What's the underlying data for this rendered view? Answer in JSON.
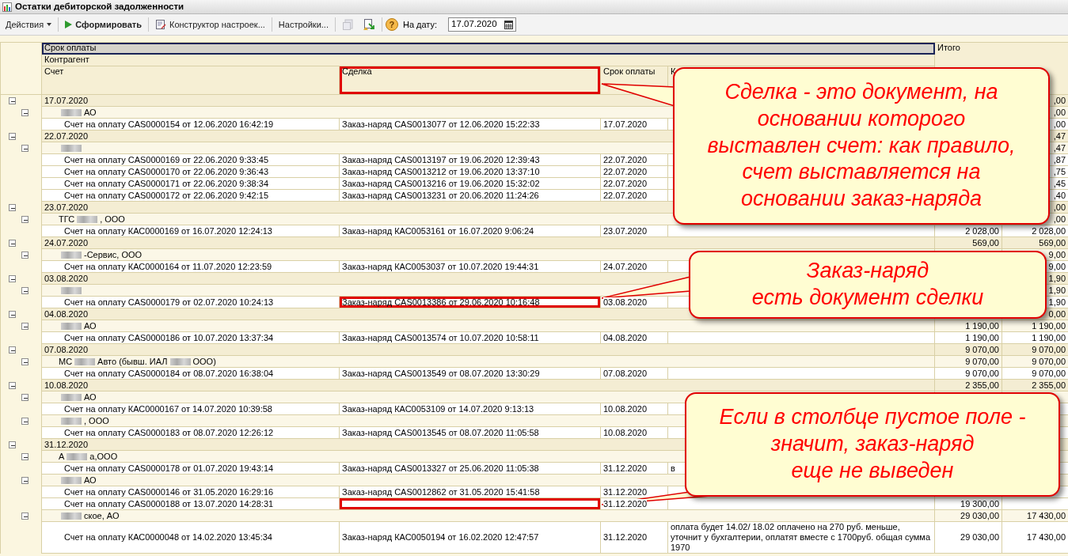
{
  "window": {
    "title": "Остатки дебиторской задолженности"
  },
  "toolbar": {
    "items": [
      {
        "kind": "menu",
        "label": "Действия",
        "disabled": false
      },
      {
        "kind": "run",
        "label": "Сформировать",
        "disabled": false
      },
      {
        "kind": "wizard",
        "label": "Конструктор настроек...",
        "disabled": false
      },
      {
        "kind": "text",
        "label": "Настройки...",
        "disabled": false
      },
      {
        "kind": "save",
        "disabled": true
      },
      {
        "kind": "load",
        "disabled": false
      },
      {
        "kind": "help",
        "label": "?",
        "disabled": false
      }
    ],
    "date_field": {
      "label": "На дату:",
      "value": "17.07.2020"
    }
  },
  "table": {
    "header": {
      "group_1": "Срок оплаты",
      "group_1_selected": true,
      "group_2": "Контрагент",
      "total": "Итого",
      "columns": [
        {
          "label": "Счет",
          "highlighted": false
        },
        {
          "label": "Сделка",
          "highlighted": true
        },
        {
          "label": "Срок оплаты",
          "highlighted": false
        },
        {
          "label": "К",
          "highlighted": false
        }
      ]
    },
    "groups": [
      {
        "date": "17.07.2020",
        "expanded": true,
        "total_2": ",00",
        "children": [
          {
            "name": [
              {
                "kind": "redacted"
              },
              {
                "kind": "text",
                "text": "АО"
              }
            ],
            "expanded": true,
            "total_2": ",00",
            "children": [
              {
                "invoice": "Счет на оплату CAS0000154 от 12.06.2020 16:42:19",
                "deal": "Заказ-наряд CAS0013077 от 12.06.2020 15:22:33",
                "highlighted": false,
                "due": "17.07.2020",
                "total_2": ",00"
              }
            ]
          }
        ]
      },
      {
        "date": "22.07.2020",
        "expanded": true,
        "total_2": ",47",
        "children": [
          {
            "name": [
              {
                "kind": "redacted"
              }
            ],
            "expanded": true,
            "total_2": ",47",
            "children": [
              {
                "invoice": "Счет на оплату CAS0000169 от 22.06.2020 9:33:45",
                "deal": "Заказ-наряд CAS0013197 от 19.06.2020 12:39:43",
                "highlighted": false,
                "due": "22.07.2020",
                "total_2": ",87"
              },
              {
                "invoice": "Счет на оплату CAS0000170 от 22.06.2020 9:36:43",
                "deal": "Заказ-наряд CAS0013212 от 19.06.2020 13:37:10",
                "highlighted": false,
                "due": "22.07.2020",
                "total_2": ",75"
              },
              {
                "invoice": "Счет на оплату CAS0000171 от 22.06.2020 9:38:34",
                "deal": "Заказ-наряд CAS0013216 от 19.06.2020 15:32:02",
                "highlighted": false,
                "due": "22.07.2020",
                "total_2": ",45"
              },
              {
                "invoice": "Счет на оплату CAS0000172 от 22.06.2020 9:42:15",
                "deal": "Заказ-наряд CAS0013231 от 20.06.2020 11:24:26",
                "highlighted": false,
                "due": "22.07.2020",
                "total_2": ",40"
              }
            ]
          }
        ]
      },
      {
        "date": "23.07.2020",
        "expanded": true,
        "total_2": ",00",
        "children": [
          {
            "name": [
              {
                "kind": "text",
                "text": "ТГС"
              },
              {
                "kind": "redacted"
              },
              {
                "kind": "text",
                "text": ", ООО"
              }
            ],
            "expanded": true,
            "total_2": ",00",
            "children": [
              {
                "invoice": "Счет на оплату КАС0000169 от 16.07.2020 12:24:13",
                "deal": "Заказ-наряд КАС0053161 от 16.07.2020 9:06:24",
                "highlighted": false,
                "due": "23.07.2020",
                "total_1": "2 028,00",
                "total_2": "2 028,00"
              }
            ]
          }
        ]
      },
      {
        "date": "24.07.2020",
        "expanded": true,
        "total_1": "569,00",
        "total_2": "569,00",
        "children": [
          {
            "name": [
              {
                "kind": "redacted"
              },
              {
                "kind": "text",
                "text": "-Сервис, ООО"
              }
            ],
            "expanded": true,
            "total_2": "9,00",
            "children": [
              {
                "invoice": "Счет на оплату КАС0000164 от 11.07.2020 12:23:59",
                "deal": "Заказ-наряд КАС0053037 от 10.07.2020 19:44:31",
                "highlighted": false,
                "due": "24.07.2020",
                "total_2": "9,00"
              }
            ]
          }
        ]
      },
      {
        "date": "03.08.2020",
        "expanded": true,
        "total_2": "1,90",
        "children": [
          {
            "name": [
              {
                "kind": "redacted"
              }
            ],
            "expanded": true,
            "total_2": "1,90",
            "children": [
              {
                "invoice": "Счет на оплату CAS0000179 от 02.07.2020 10:24:13",
                "deal": "Заказ-наряд CAS0013386 от 29.06.2020 10:16:48",
                "highlighted": true,
                "due": "03.08.2020",
                "total_2": "1,90"
              }
            ]
          }
        ]
      },
      {
        "date": "04.08.2020",
        "expanded": true,
        "total_2": "0,00",
        "children": [
          {
            "name": [
              {
                "kind": "redacted"
              },
              {
                "kind": "text",
                "text": "АО"
              }
            ],
            "expanded": true,
            "total_1": "1 190,00",
            "total_2": "1 190,00",
            "children": [
              {
                "invoice": "Счет на оплату CAS0000186 от 10.07.2020 13:37:34",
                "deal": "Заказ-наряд CAS0013574 от 10.07.2020 10:58:11",
                "highlighted": false,
                "due": "04.08.2020",
                "total_1": "1 190,00",
                "total_2": "1 190,00"
              }
            ]
          }
        ]
      },
      {
        "date": "07.08.2020",
        "expanded": true,
        "total_1": "9 070,00",
        "total_2": "9 070,00",
        "children": [
          {
            "name": [
              {
                "kind": "text",
                "text": "МС"
              },
              {
                "kind": "redacted"
              },
              {
                "kind": "text",
                "text": "Авто (бывш. ИАЛ"
              },
              {
                "kind": "redacted"
              },
              {
                "kind": "text",
                "text": "ООО)"
              }
            ],
            "expanded": true,
            "total_1": "9 070,00",
            "total_2": "9 070,00",
            "children": [
              {
                "invoice": "Счет на оплату CAS0000184 от 08.07.2020 16:38:04",
                "deal": "Заказ-наряд CAS0013549 от 08.07.2020 13:30:29",
                "highlighted": false,
                "due": "07.08.2020",
                "total_1": "9 070,00",
                "total_2": "9 070,00"
              }
            ]
          }
        ]
      },
      {
        "date": "10.08.2020",
        "expanded": true,
        "total_1": "2 355,00",
        "total_2": "2 355,00",
        "children": [
          {
            "name": [
              {
                "kind": "redacted"
              },
              {
                "kind": "text",
                "text": "АО"
              }
            ],
            "expanded": true,
            "children": [
              {
                "invoice": "Счет на оплату КАС0000167 от 14.07.2020 10:39:58",
                "deal": "Заказ-наряд КАС0053109 от 14.07.2020 9:13:13",
                "highlighted": false,
                "due": "10.08.2020"
              }
            ]
          },
          {
            "name": [
              {
                "kind": "redacted"
              },
              {
                "kind": "text",
                "text": ", ООО"
              }
            ],
            "expanded": true,
            "children": [
              {
                "invoice": "Счет на оплату CAS0000183 от 08.07.2020 12:26:12",
                "deal": "Заказ-наряд CAS0013545 от 08.07.2020 11:05:58",
                "highlighted": false,
                "due": "10.08.2020"
              }
            ]
          }
        ]
      },
      {
        "date": "31.12.2020",
        "expanded": true,
        "children": [
          {
            "name": [
              {
                "kind": "text",
                "text": "А"
              },
              {
                "kind": "redacted"
              },
              {
                "kind": "text",
                "text": "а,ООО"
              }
            ],
            "expanded": true,
            "children": [
              {
                "invoice": "Счет на оплату CAS0000178 от 01.07.2020 19:43:14",
                "deal": "Заказ-наряд CAS0013327 от 25.06.2020 11:05:38",
                "highlighted": false,
                "due": "31.12.2020",
                "comment": "в"
              }
            ]
          },
          {
            "name": [
              {
                "kind": "redacted"
              },
              {
                "kind": "text",
                "text": "АО"
              }
            ],
            "expanded": true,
            "children": [
              {
                "invoice": "Счет на оплату CAS0000146 от 31.05.2020 16:29:16",
                "deal": "Заказ-наряд CAS0012862 от 31.05.2020 15:41:58",
                "highlighted": false,
                "due": "31.12.2020"
              },
              {
                "invoice": "Счет на оплату CAS0000188 от 13.07.2020 14:28:31",
                "highlighted": true,
                "due": "31.12.2020",
                "total_1": "19 300,00"
              }
            ]
          },
          {
            "name": [
              {
                "kind": "redacted"
              },
              {
                "kind": "text",
                "text": "ское, АО"
              }
            ],
            "expanded": true,
            "total_1": "29 030,00",
            "total_2": "17 430,00",
            "children": [
              {
                "invoice": "Счет на оплату КАС0000048 от 14.02.2020 13:45:34",
                "deal": "Заказ-наряд КАС0050194 от 16.02.2020 12:47:57",
                "highlighted": false,
                "due": "31.12.2020",
                "comment": "оплата будет 14.02/ 18.02 оплачено на 270 руб. меньше, уточнит у бухгалтерии, оплатят вместе с 1700руб. общая сумма 1970",
                "total_1": "29 030,00",
                "total_2": "17 430,00"
              }
            ]
          }
        ]
      }
    ]
  },
  "callouts": [
    {
      "text": "Сделка - это документ, на\nосновании которого\nвыставлен счет: как правило,\nсчет выставляется на\nосновании заказ-наряда"
    },
    {
      "text": "Заказ-наряд\nесть документ сделки"
    },
    {
      "text": "Если в столбце пустое поле -\nзначит, заказ-наряд\nеще не выведен"
    }
  ]
}
